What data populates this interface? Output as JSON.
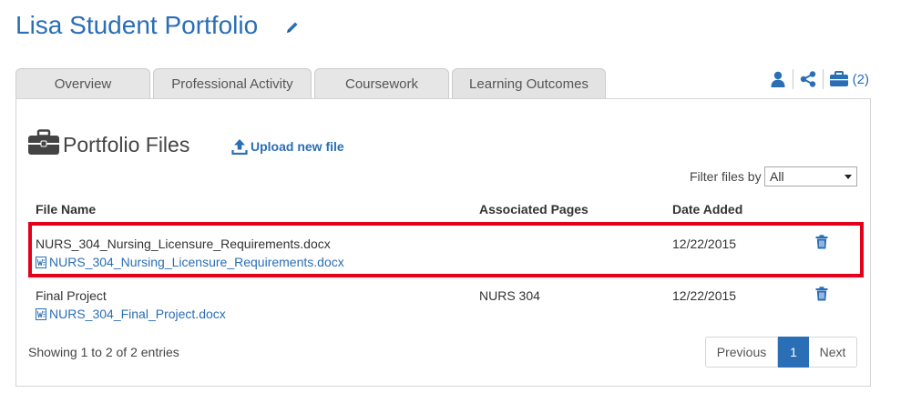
{
  "header": {
    "title": "Lisa Student Portfolio"
  },
  "tabs": [
    {
      "label": "Overview"
    },
    {
      "label": "Professional Activity"
    },
    {
      "label": "Coursework"
    },
    {
      "label": "Learning Outcomes"
    }
  ],
  "top_actions": {
    "portfolio_count": "(2)"
  },
  "section": {
    "title": "Portfolio Files",
    "upload_label": "Upload new file"
  },
  "filter": {
    "label": "Filter files by",
    "selected": "All"
  },
  "table": {
    "headers": {
      "file_name": "File Name",
      "associated_pages": "Associated Pages",
      "date_added": "Date Added"
    },
    "rows": [
      {
        "title": "NURS_304_Nursing_Licensure_Requirements.docx",
        "file": "NURS_304_Nursing_Licensure_Requirements.docx",
        "associated_pages": "",
        "date_added": "12/22/2015"
      },
      {
        "title": "Final Project",
        "file": "NURS_304_Final_Project.docx",
        "associated_pages": "NURS 304",
        "date_added": "12/22/2015"
      }
    ]
  },
  "footer": {
    "showing": "Showing 1 to 2 of 2 entries"
  },
  "pagination": {
    "previous": "Previous",
    "current": "1",
    "next": "Next"
  },
  "colors": {
    "accent": "#2a6eb5",
    "highlight": "#e3001b"
  }
}
